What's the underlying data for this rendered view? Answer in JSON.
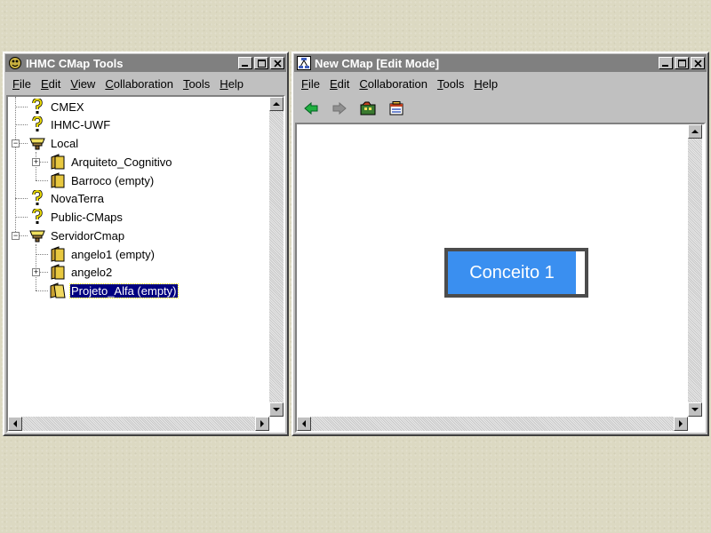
{
  "left_window": {
    "title": "IHMC CMap Tools",
    "menu": [
      "File",
      "Edit",
      "View",
      "Collaboration",
      "Tools",
      "Help"
    ],
    "tree": [
      {
        "label": "CMEX",
        "icon": "question-icon",
        "level": 0
      },
      {
        "label": "IHMC-UWF",
        "icon": "question-icon",
        "level": 0
      },
      {
        "label": "Local",
        "icon": "server-icon",
        "level": 0,
        "expanded": true
      },
      {
        "label": "Arquiteto_Cognitivo",
        "icon": "folder-icon",
        "level": 1,
        "collapsed": true
      },
      {
        "label": "Barroco  (empty)",
        "icon": "folder-icon",
        "level": 1
      },
      {
        "label": "NovaTerra",
        "icon": "question-icon",
        "level": 0
      },
      {
        "label": "Public-CMaps",
        "icon": "question-icon",
        "level": 0
      },
      {
        "label": "ServidorCmap",
        "icon": "server-icon",
        "level": 0,
        "expanded": true
      },
      {
        "label": "angelo1  (empty)",
        "icon": "folder-icon",
        "level": 1
      },
      {
        "label": "angelo2",
        "icon": "folder-icon",
        "level": 1,
        "collapsed": true
      },
      {
        "label": "Projeto_Alfa  (empty)",
        "icon": "folder-open-icon",
        "level": 1,
        "selected": true
      }
    ]
  },
  "right_window": {
    "title": "New CMap  [Edit Mode]",
    "menu": [
      "File",
      "Edit",
      "Collaboration",
      "Tools",
      "Help"
    ],
    "toolbar": [
      "back-arrow-icon",
      "forward-arrow-icon",
      "cmap-folder-icon",
      "properties-icon"
    ],
    "concept": {
      "label": "Conceito 1"
    }
  },
  "colors": {
    "titlebar_inactive": "#808080",
    "window_face": "#c0c0c0",
    "selection": "#000080",
    "concept_fill": "#3a8ff0"
  }
}
